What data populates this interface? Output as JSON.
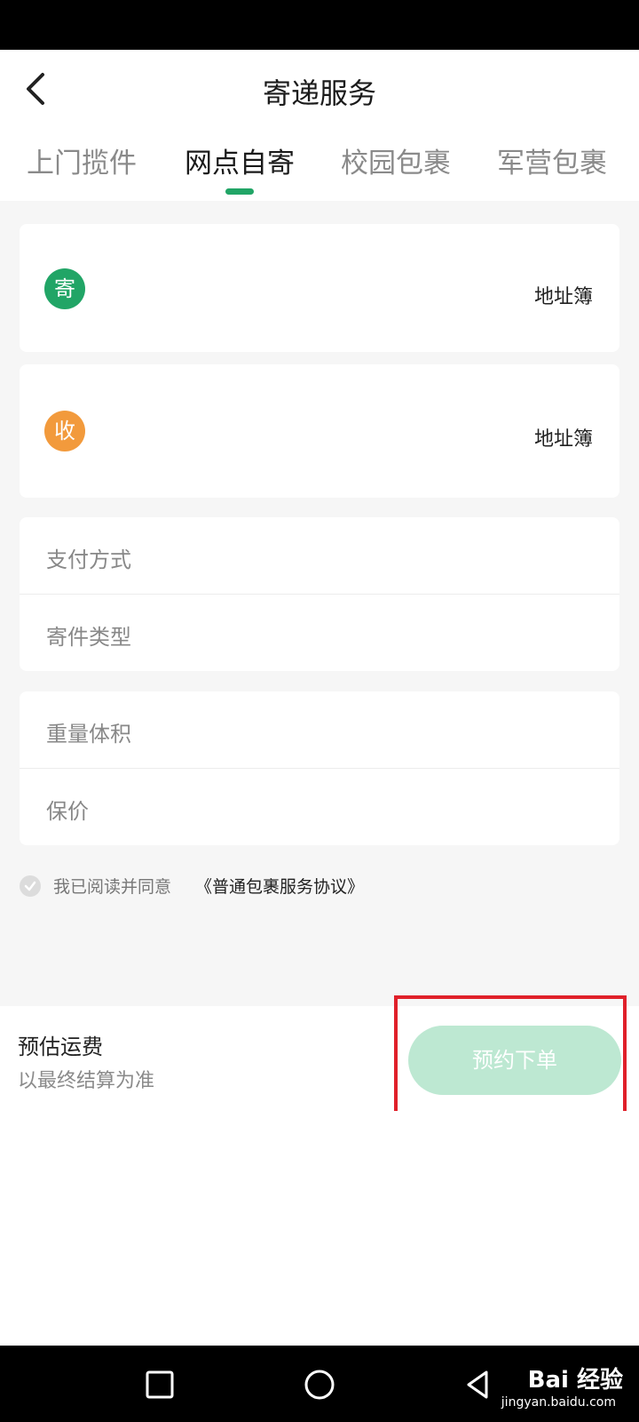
{
  "header": {
    "title": "寄递服务",
    "tabs": [
      {
        "label": "上门揽件",
        "active": false
      },
      {
        "label": "网点自寄",
        "active": true
      },
      {
        "label": "校园包裹",
        "active": false
      },
      {
        "label": "军营包裹",
        "active": false
      }
    ]
  },
  "address": {
    "sender": {
      "badge": "寄",
      "book_label": "地址簿"
    },
    "receiver": {
      "badge": "收",
      "book_label": "地址簿"
    }
  },
  "form_rows": [
    {
      "label": "支付方式"
    },
    {
      "label": "寄件类型"
    },
    {
      "label": "重量体积"
    },
    {
      "label": "保价"
    }
  ],
  "agreement": {
    "text": "我已阅读并同意",
    "link": "《普通包裹服务协议》"
  },
  "footer": {
    "fee_title": "预估运费",
    "fee_note": "以最终结算为准",
    "order_button": "预约下单"
  },
  "watermark": {
    "brand": "Bai 经验",
    "site": "jingyan.baidu.com"
  },
  "colors": {
    "accent": "#21a566",
    "receiver_badge": "#f29a3c",
    "button_disabled": "#bde8d2",
    "highlight": "#e0202a"
  },
  "icons": [
    "back-arrow-icon",
    "check-circle-icon",
    "nav-recent-icon",
    "nav-home-icon",
    "nav-back-icon"
  ]
}
